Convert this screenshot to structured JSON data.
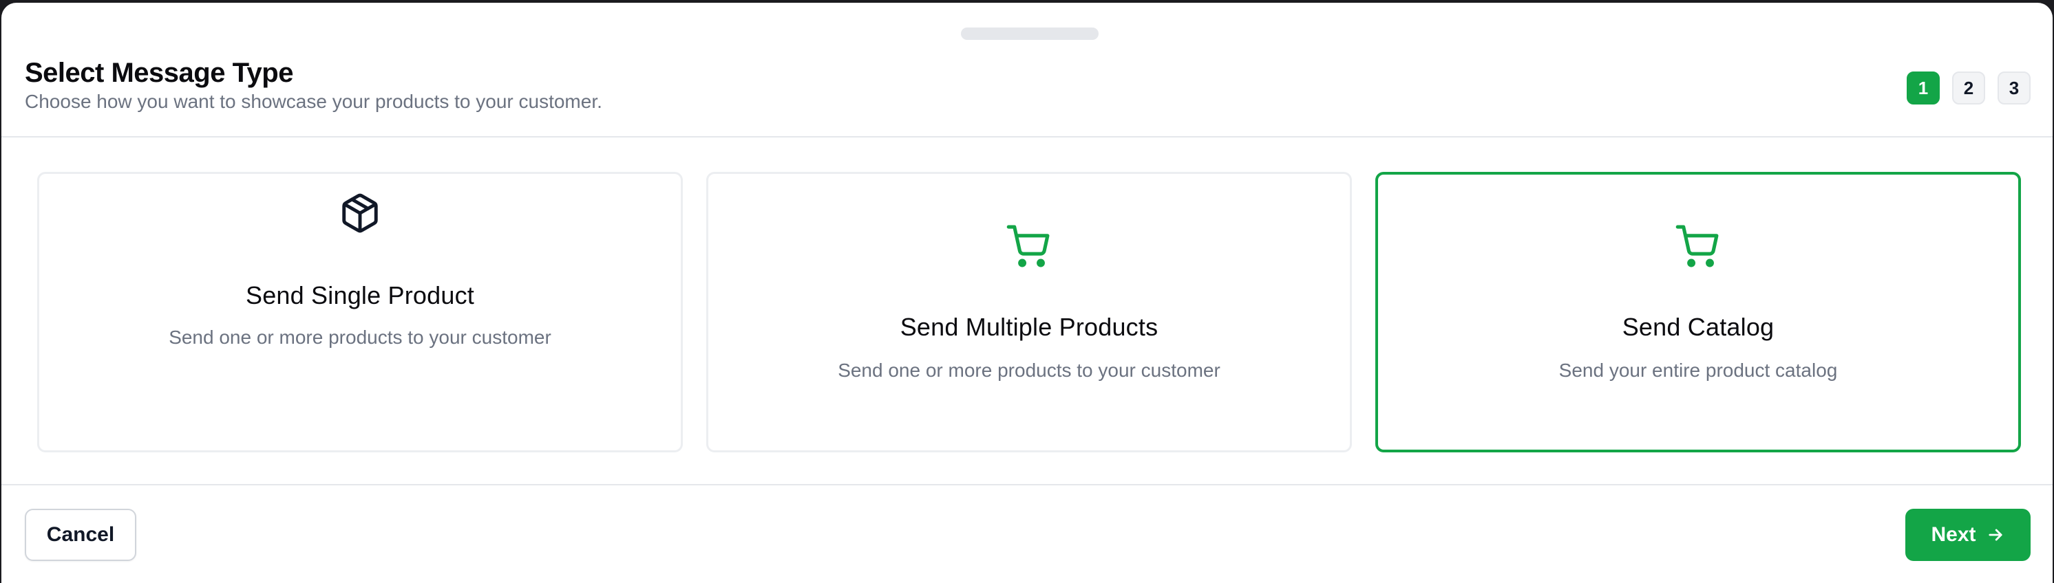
{
  "header": {
    "title": "Select Message Type",
    "subtitle": "Choose how you want to showcase your products to your customer.",
    "steps": [
      "1",
      "2",
      "3"
    ],
    "active_step": 1
  },
  "options": [
    {
      "title": "Send Single Product",
      "description": "Send one or more products to your customer",
      "icon": "package-icon",
      "selected": false
    },
    {
      "title": "Send Multiple Products",
      "description": "Send one or more products to your customer",
      "icon": "shopping-cart-icon",
      "selected": false
    },
    {
      "title": "Send Catalog",
      "description": "Send your entire product catalog",
      "icon": "shopping-cart-icon",
      "selected": true
    }
  ],
  "footer": {
    "cancel_label": "Cancel",
    "next_label": "Next",
    "next_icon": "arrow-right-icon"
  },
  "colors": {
    "accent": "#13a547",
    "border": "#e5e7eb",
    "muted_text": "#6b7280"
  }
}
